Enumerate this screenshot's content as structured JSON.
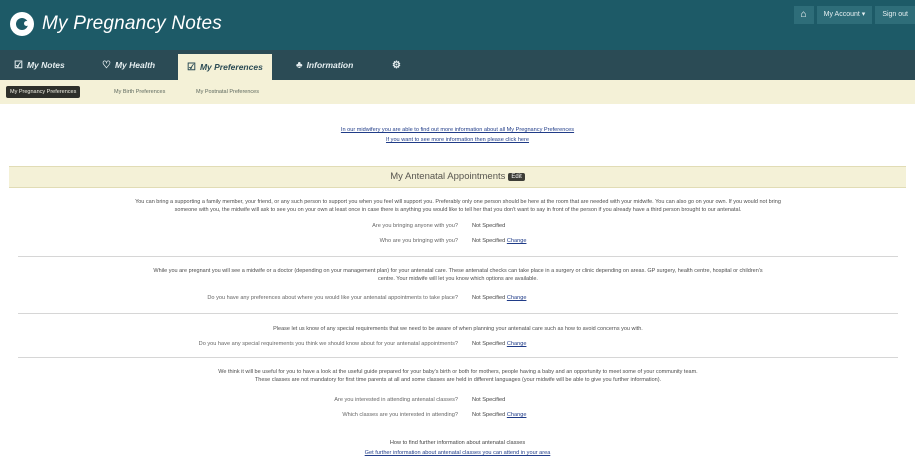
{
  "app": {
    "title": "My Pregnancy Notes",
    "colors": {
      "header": "#1d5a67",
      "nav": "#2b4b55",
      "accent_bg": "#f4f1d7",
      "link": "#203c88"
    }
  },
  "account": {
    "home_icon": "home-icon",
    "my_account": "My Account ▾",
    "sign_out": "Sign out"
  },
  "nav": [
    {
      "label": "My Notes",
      "icon": "notes-icon",
      "glyph": "☑"
    },
    {
      "label": "My Health",
      "icon": "heart-icon",
      "glyph": "♡"
    },
    {
      "label": "My Preferences",
      "icon": "checklist-icon",
      "glyph": "☑"
    },
    {
      "label": "Information",
      "icon": "people-icon",
      "glyph": "👥"
    },
    {
      "label": "",
      "icon": "gear-icon",
      "glyph": "⚙"
    }
  ],
  "subtabs": [
    {
      "label": "My Pregnancy Preferences"
    },
    {
      "label": "My Birth Preferences"
    },
    {
      "label": "My Postnatal Preferences"
    }
  ],
  "notice": {
    "line1": "In our midwifery you are able to find out more information about all My Pregnancy Preferences",
    "line2": "If you want to see more information then please click here"
  },
  "section": {
    "title": "My Antenatal Appointments",
    "badge": "Edit"
  },
  "paras": {
    "p1a": "You can bring a supporting a family member, your friend, or any such person to support you when you feel will support you. Preferably only one person should be here at the room that are needed with your midwife. You can also go on your own. If you would not bring",
    "p1b": "someone with you, the midwife will ask to see you on your own at least once in case there is anything you would like to tell her that you don't want to say in front of the person if you already have a third person brought to our antenatal.",
    "p2a": "While you are pregnant you will see a midwife or a doctor (depending on your management plan) for your antenatal care. These antenatal checks can take place in a surgery or clinic depending on areas. GP surgery, health centre, hospital or children's",
    "p2b": "centre. Your midwife will let you know which options are available.",
    "p3": "Please let us know of any special requirements that we need to be aware of when planning your antenatal care such as how to avoid concerns you with.",
    "p4a": "We think it will be useful for you to have a look at the useful guide prepared for your baby's birth or both for mothers, people having a baby and an opportunity to meet some of your community team.",
    "p4b": "These classes are not mandatory for first time parents at all and some classes are held in different languages (your midwife will be able to give you further information)."
  },
  "questions": {
    "q1": "Are you bringing anyone with you?",
    "a1": "Not Specified",
    "q2": "Who are you bringing with you?",
    "a2": "Not Specified",
    "q3": "Do you have any preferences about where you would like your antenatal appointments to take place?",
    "a3": "Not Specified",
    "q4": "Do you have any special requirements you think we should know about for your antenatal appointments?",
    "a4": "Not Specified",
    "q5": "Are you interested in attending antenatal classes?",
    "a5": "Not Specified",
    "q6": "Which classes are you interested in attending?",
    "a6": "Not Specified"
  },
  "change_label": "Change",
  "footer": {
    "line1": "How to find further information about antenatal classes",
    "line2": "Get further information about antenatal classes you can attend in your area"
  }
}
